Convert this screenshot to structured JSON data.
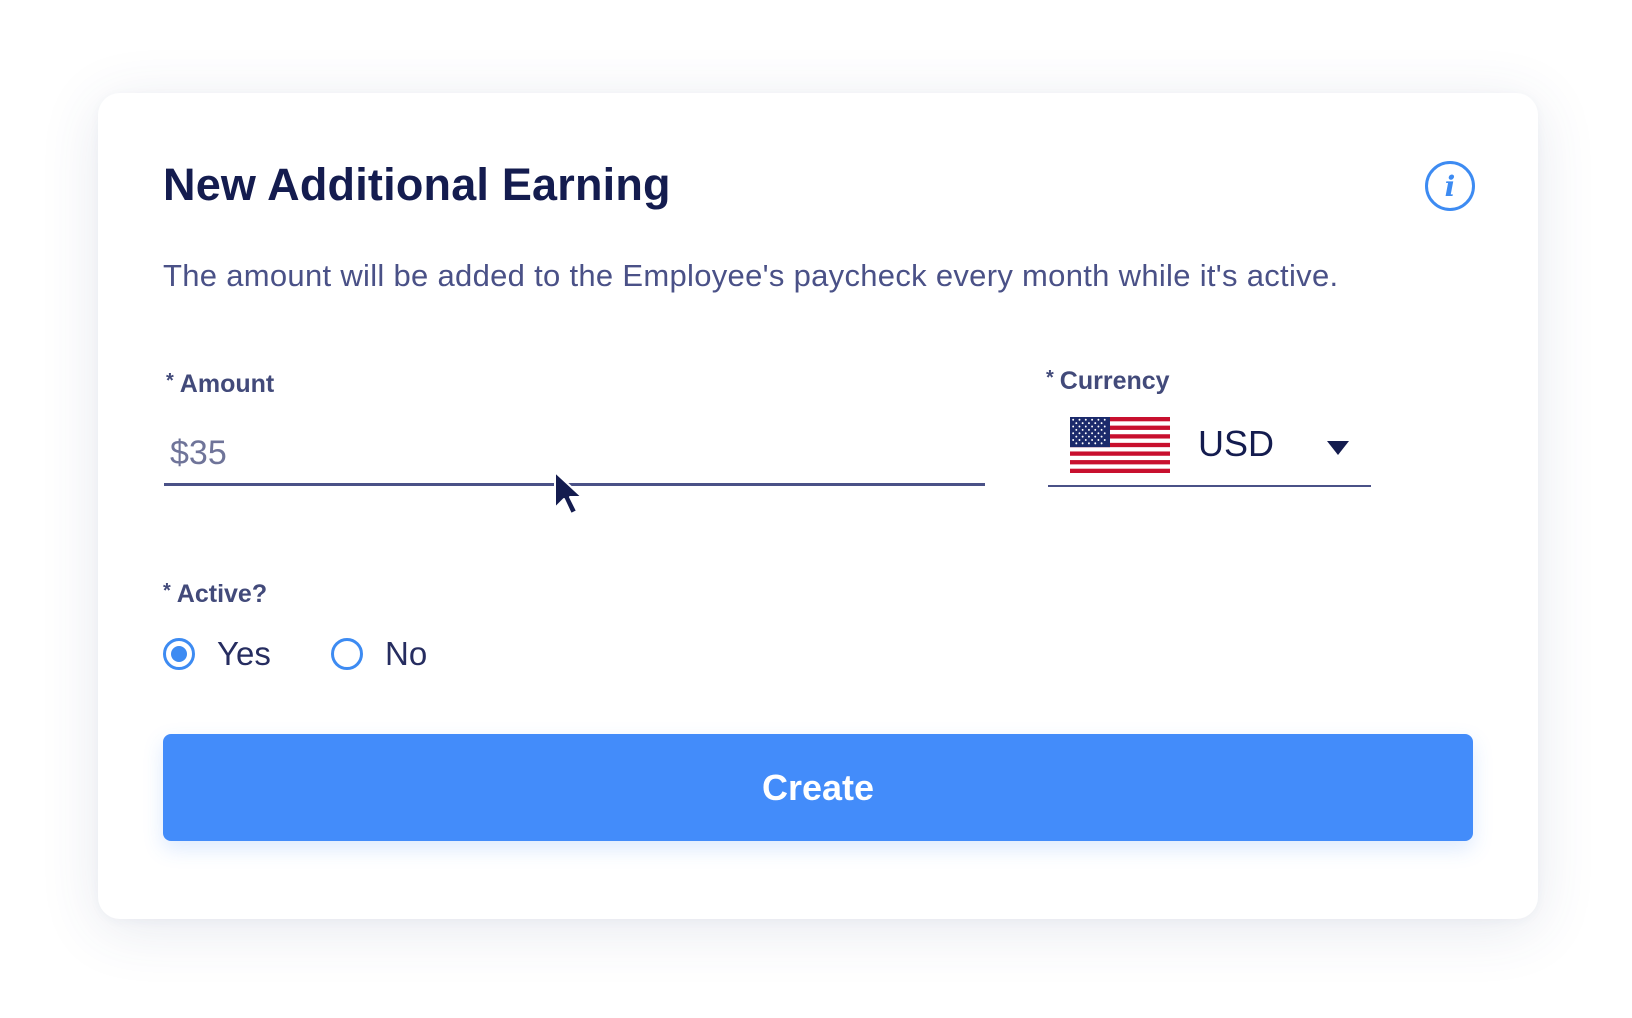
{
  "form": {
    "title": "New Additional Earning",
    "description": "The amount will be added to the Employee's paycheck every month while it's active.",
    "info_icon": "info-icon",
    "required_mark": "*"
  },
  "amount": {
    "label": "Amount",
    "value": "$35"
  },
  "currency": {
    "label": "Currency",
    "value": "USD",
    "flag_icon": "us-flag-icon"
  },
  "active": {
    "label": "Active?",
    "options": [
      {
        "label": "Yes",
        "selected": true
      },
      {
        "label": "No",
        "selected": false
      }
    ]
  },
  "actions": {
    "create_label": "Create"
  },
  "colors": {
    "primary": "#438cfa",
    "title": "#141c4f",
    "text_muted": "#4a5187"
  }
}
